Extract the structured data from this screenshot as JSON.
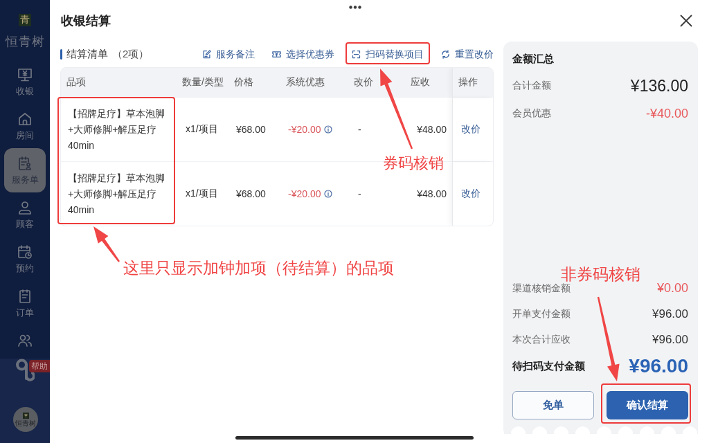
{
  "sidebar": {
    "logo_mark": "青",
    "brand": "恒青树",
    "items": [
      {
        "label": "收银",
        "selected": false
      },
      {
        "label": "房间",
        "selected": false
      },
      {
        "label": "服务单",
        "selected": true
      },
      {
        "label": "顾客",
        "selected": false
      },
      {
        "label": "预约",
        "selected": false
      },
      {
        "label": "订单",
        "selected": false
      },
      {
        "selected": false
      }
    ],
    "help_badge": "帮助",
    "avatar_label": "恒青树"
  },
  "dialog": {
    "title": "收银结算"
  },
  "settlement_list": {
    "title": "结算清单",
    "count": "（2项）",
    "actions": [
      {
        "label": "服务备注"
      },
      {
        "label": "选择优惠券"
      },
      {
        "label": "扫码替换项目"
      },
      {
        "label": "重置改价"
      }
    ],
    "table": {
      "columns": [
        "品项",
        "数量/类型",
        "价格",
        "系统优惠",
        "改价",
        "应收",
        "操作"
      ],
      "rows": [
        {
          "item": "【招牌足疗】草本泡脚+大师修脚+解压足疗40min",
          "quantity_type": "x1/项目",
          "price": "¥68.00",
          "system_discount": "-¥20.00",
          "price_adjustment": "-",
          "receivable": "¥48.00",
          "action": "改价"
        },
        {
          "item": "【招牌足疗】草本泡脚+大师修脚+解压足疗40min",
          "quantity_type": "x1/项目",
          "price": "¥68.00",
          "system_discount": "-¥20.00",
          "price_adjustment": "-",
          "receivable": "¥48.00",
          "action": "改价"
        }
      ]
    }
  },
  "summary": {
    "title": "金额汇总",
    "rows": [
      {
        "label": "合计金额",
        "value": "¥136.00",
        "kind": "total"
      },
      {
        "label": "会员优惠",
        "value": "-¥40.00",
        "kind": "deduction"
      }
    ],
    "detail_rows": [
      {
        "label": "渠道核销金额",
        "value": "¥0.00",
        "kind": "deduction"
      },
      {
        "label": "开单支付金额",
        "value": "¥96.00",
        "kind": "plain"
      },
      {
        "label": "本次合计应收",
        "value": "¥96.00",
        "kind": "plain"
      }
    ],
    "due": {
      "label": "待扫码支付金额",
      "value": "¥96.00"
    },
    "buttons": [
      {
        "label": "免单",
        "kind": "secondary"
      },
      {
        "label": "确认结算",
        "kind": "primary"
      }
    ]
  },
  "annotations": [
    {
      "text": "券码核销"
    },
    {
      "text": "这里只显示加钟加项（待结算）的品项"
    },
    {
      "text": "非券码核销"
    }
  ]
}
